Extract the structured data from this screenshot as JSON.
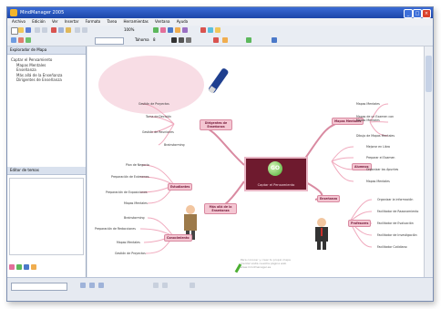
{
  "window": {
    "title": "MindManager 2005",
    "min": "_",
    "max": "□",
    "close": "×"
  },
  "menu": [
    "Archivo",
    "Edición",
    "Ver",
    "Insertar",
    "Formato",
    "Tarea",
    "Herramientas",
    "Ventana",
    "Ayuda"
  ],
  "toolbar": {
    "zoom": "100%",
    "style": "Tahoma",
    "size": "8"
  },
  "sidebar": {
    "header": "Explorador de Mapa",
    "tree": [
      "Captar el Pensamiento",
      "Mapas Mentales",
      "Enseñanza",
      "Más allá de la Enseñanza",
      "Dirigentes de Enseñanza"
    ],
    "notes_header": "Editor de temas"
  },
  "map": {
    "central": "Captar el Pensamiento",
    "central_badge": "GO",
    "main_topics": [
      "Dirigentes de Enseñanza",
      "Mapas Mentales",
      "Enseñanza",
      "Más allá de la Enseñanza"
    ],
    "subtopics": {
      "dirigentes": [
        "Gestión de Proyectos",
        "Toma de Decisión",
        "Gestión de Reuniones",
        "Brainstorming"
      ],
      "mapas": [
        "Mapas Mentales",
        "Mapas de un Examen con Mapas Mentales",
        "Dibujo de Mapas Mentales"
      ],
      "ensenanza_alumnos": [
        "Mejorar en Libro",
        "Preparar el Examen",
        "Organizar los Apuntes",
        "Mapas Mentales"
      ],
      "ensenanza_profesores": [
        "Organizar la información",
        "Facilitador de Razonamiento",
        "Facilitador de Evaluación",
        "Facilitador de Investigación",
        "Facilitador Cotidiano"
      ],
      "mas_alla_estudiantes": [
        "Plan de Negocio",
        "Preparación de Exámenes",
        "Preparación de Exposiciones",
        "Mapas Mentales"
      ],
      "mas_alla_conocimiento": [
        "Brainstorming",
        "Preparación de Redacciones",
        "Mapas Mentales",
        "Gestión de Proyectos"
      ]
    },
    "branch_labels": {
      "alumnos": "Alumnos",
      "profesores": "Profesores",
      "estudiantes": "Estudiantes",
      "conocimiento": "Conocimiento"
    },
    "note": [
      "Para conocer y crear tu propio mapa",
      "mental visita nuestra página web",
      "www.mindmanager.es"
    ]
  },
  "colors": {
    "accent": "#d98aa1",
    "central": "#6e1a2e",
    "green": "#4caf32"
  }
}
